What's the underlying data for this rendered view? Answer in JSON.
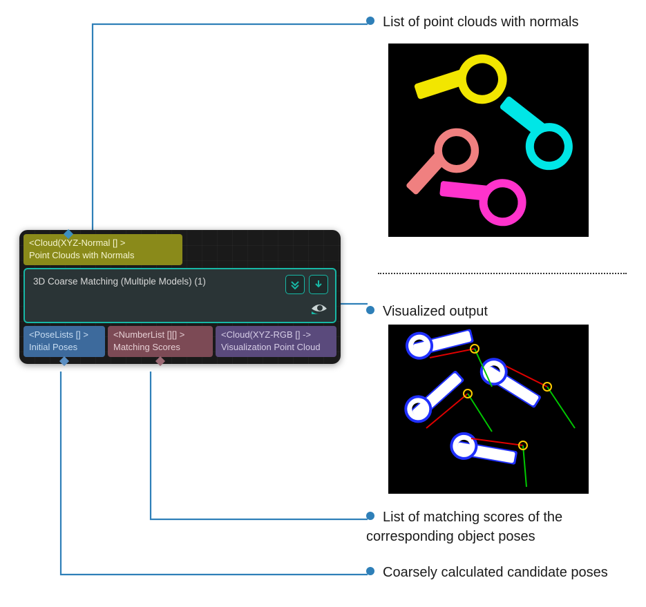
{
  "node": {
    "input_port": {
      "type": "<Cloud(XYZ-Normal [] >",
      "label": "Point Clouds with Normals"
    },
    "title": "3D Coarse Matching (Multiple Models) (1)",
    "actions": {
      "expand_icon": "expand",
      "download_icon": "download",
      "visualize_icon": "eye"
    },
    "output_ports": [
      {
        "type": "<PoseLists [] >",
        "label": "Initial Poses"
      },
      {
        "type": "<NumberList [][] >",
        "label": "Matching Scores"
      },
      {
        "type": "<Cloud(XYZ-RGB [] ->",
        "label": "Visualization Point Cloud"
      }
    ]
  },
  "annotations": {
    "input": "List of point clouds with normals",
    "vis": "Visualized output",
    "scores": "List of matching scores of the corresponding object poses",
    "poses": "Coarsely calculated candidate poses"
  },
  "thumbnails": {
    "top_alt": "segmented connecting-rod point clouds (4 colored objects)",
    "bottom_alt": "visualized matched poses with coordinate axes"
  }
}
